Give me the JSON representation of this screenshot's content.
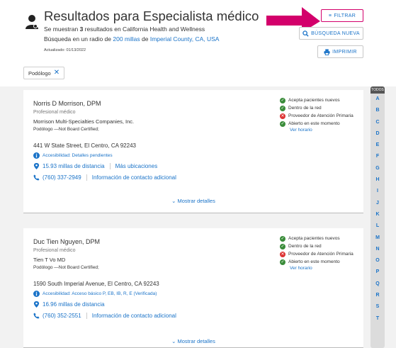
{
  "header": {
    "title": "Resultados para Especialista médico",
    "subtitle_prefix": "Se muestran ",
    "result_count": "3",
    "subtitle_suffix": " resultados en California Health and Wellness",
    "radius_prefix": "Búsqueda en un radio de ",
    "radius_value": "200 millas",
    "radius_mid": " de ",
    "location": "Imperial County, CA, USA",
    "updated": "Actualizado: 01/13/2022"
  },
  "buttons": {
    "filter": "FILTRAR",
    "new_search": "BÚSQUEDA NUEVA",
    "print": "IMPRIMIR"
  },
  "chips": [
    {
      "label": "Podólogo"
    }
  ],
  "colors": {
    "link": "#1a73c8",
    "highlight": "#d3006b",
    "ok": "#3a8c3a",
    "no": "#d33"
  },
  "providers": [
    {
      "name": "Norris D Morrison, DPM",
      "role": "Profesional médico",
      "org": "Morrison Multi-Specialties Companies, Inc.",
      "specialty": "Podólogo —Not Board Certified;",
      "address": "441 W State Street, El Centro, CA 92243",
      "accessibility": "Accesibilidad: Detalles pendientes",
      "distance": "15.93 millas de distancia",
      "more_locations": "Más ubicaciones",
      "phone": "(760) 337-2949",
      "contact_info": "Información de contacto adicional",
      "show_details": "Mostrar detalles",
      "status": [
        {
          "label": "Acepta pacientes nuevos",
          "ok": true
        },
        {
          "label": "Dentro de la red",
          "ok": true
        },
        {
          "label": "Proveedor de Atención Primaria",
          "ok": false
        },
        {
          "label": "Abierto en este momento",
          "ok": true
        }
      ],
      "hours_link": "Ver horario"
    },
    {
      "name": "Duc Tien Nguyen, DPM",
      "role": "Profesional médico",
      "org": "Tien T Vo MD",
      "specialty": "Podólogo —Not Board Certified;",
      "address": "1590 South Imperial Avenue, El Centro, CA 92243",
      "accessibility": "Accesibilidad: Acceso básico P, EB, IB, R, E (Verificada)",
      "distance": "16.96 millas de distancia",
      "phone": "(760) 352-2551",
      "contact_info": "Información de contacto adicional",
      "show_details": "Mostrar detalles",
      "status": [
        {
          "label": "Acepta pacientes nuevos",
          "ok": true
        },
        {
          "label": "Dentro de la red",
          "ok": true
        },
        {
          "label": "Proveedor de Atención Primaria",
          "ok": false
        },
        {
          "label": "Abierto en este momento",
          "ok": true
        }
      ],
      "hours_link": "Ver horario"
    }
  ],
  "alphabet": {
    "all_label": "TODOS",
    "letters": [
      "A",
      "B",
      "C",
      "D",
      "E",
      "F",
      "G",
      "H",
      "I",
      "J",
      "K",
      "L",
      "M",
      "N",
      "O",
      "P",
      "Q",
      "R",
      "S",
      "T"
    ]
  }
}
